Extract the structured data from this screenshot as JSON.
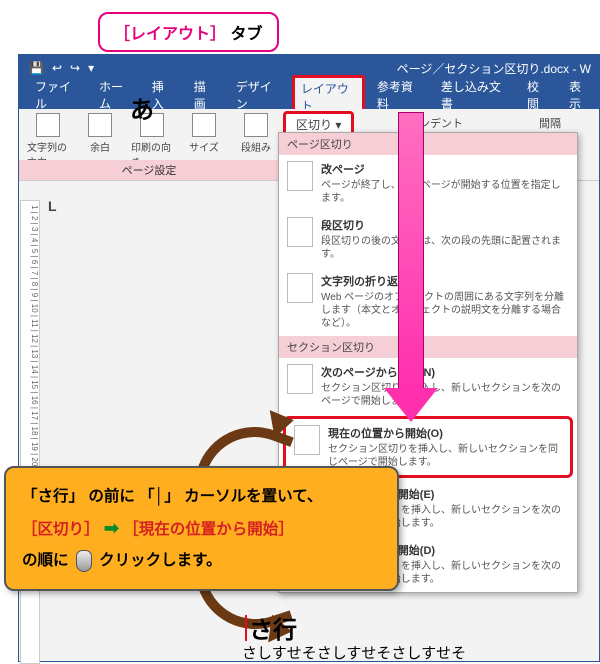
{
  "top_callout": {
    "bracket_open": "［",
    "tab_name": "レイアウト",
    "bracket_close": "］",
    "suffix": "タブ"
  },
  "titlebar": {
    "doc_title": "ページ／セクション区切り.docx - W"
  },
  "qat": {
    "save": "💾",
    "undo": "↩",
    "redo": "↪",
    "more": "▾"
  },
  "menu": {
    "file": "ファイル",
    "home": "ホーム",
    "insert": "挿入",
    "draw": "描画",
    "design": "デザイン",
    "layout": "レイアウト",
    "references": "参考資料",
    "mailings": "差し込み文書",
    "review": "校閲",
    "view": "表示"
  },
  "ribbon": {
    "buttons": {
      "direction": "文字列の方向",
      "margins": "余白",
      "orientation": "印刷の向き",
      "size": "サイズ",
      "columns": "段組み"
    },
    "group_label": "ページ設定",
    "breaks_btn": "区切り ▾",
    "indent": "ンデント",
    "spacing": "間隔"
  },
  "dropdown": {
    "section1": "ページ区切り",
    "items1": [
      {
        "title": "改ページ",
        "desc": "ページが終了し、次のページが開始する位置を指定します。"
      },
      {
        "title": "段区切り",
        "desc": "段区切りの後の文字列は、次の段の先頭に配置されます。"
      },
      {
        "title": "文字列の折り返し(T)",
        "desc": "Web ページのオブジェクトの周囲にある文字列を分離します（本文とオブジェクトの説明文を分離する場合など）。"
      }
    ],
    "section2": "セクション区切り",
    "items2": [
      {
        "title": "次のページから開始(N)",
        "desc": "セクション区切りを挿入し、新しいセクションを次のページで開始します。"
      },
      {
        "title": "現在の位置から開始(O)",
        "desc": "セクション区切りを挿入し、新しいセクションを同じページで開始します。"
      },
      {
        "title": "偶数ページから開始(E)",
        "desc": "セクション区切りを挿入し、新しいセクションを次の偶数ページで開始します。"
      },
      {
        "title": "奇数ページから開始(D)",
        "desc": "セクション区切りを挿入し、新しいセクションを次の奇数ページで開始します。"
      }
    ]
  },
  "doc": {
    "heading_visible": "あ",
    "sagyou": "さ行",
    "kana": "さしすせそさしすせそさしすせそ"
  },
  "orange": {
    "l1a": "「さ行」",
    "l1b": "の前に",
    "l1c": "「│」",
    "l1d": "カーソルを置いて、",
    "l2a": "［区切り］",
    "l2b": "［現在の位置から開始］",
    "l3a": "の順に",
    "l3b": "クリック",
    "l3c": "します。"
  },
  "ruler_v": "1 | 2 | 3 | 4 | 5 | 6 | 7 | 8 | 9 | 10 | 11 | 12 | 13 | 14 | 15 | 16 | 17 | 18 | 19 | 20"
}
